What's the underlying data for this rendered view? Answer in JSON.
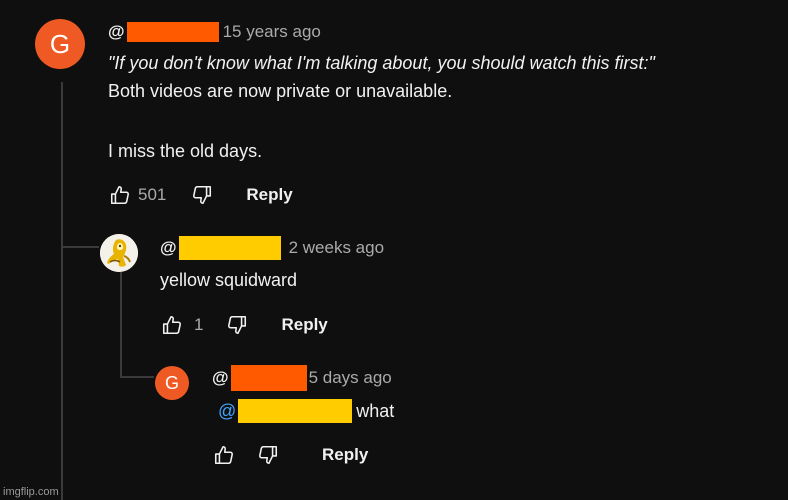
{
  "colors": {
    "background": "#0f0f0f",
    "text": "#f1f1f1",
    "muted": "#aaaaaa",
    "avatar_orange": "#ef5a24",
    "redact_orange": "#ff5a00",
    "redact_yellow": "#ffcc00",
    "mention_blue": "#3ea6ff",
    "thread_line": "#3a3a3a"
  },
  "icons": {
    "like": "thumb-up-icon",
    "dislike": "thumb-down-icon"
  },
  "comment": {
    "avatar_letter": "G",
    "handle_prefix": "@",
    "time": "15 years ago",
    "lines": [
      "\"If you don't know what I'm talking about, you should watch this first:\"",
      "Both videos are now private or unavailable.",
      "I miss the old days."
    ],
    "likes": "501",
    "reply_label": "Reply"
  },
  "reply1": {
    "handle_prefix": "@",
    "time": "2 weeks ago",
    "text": "yellow squidward",
    "likes": "1",
    "reply_label": "Reply"
  },
  "reply2": {
    "avatar_letter": "G",
    "handle_prefix": "@",
    "time": "5 days ago",
    "mention_prefix": "@",
    "text_after_mention": "what",
    "reply_label": "Reply"
  },
  "watermark": "imgflip.com"
}
